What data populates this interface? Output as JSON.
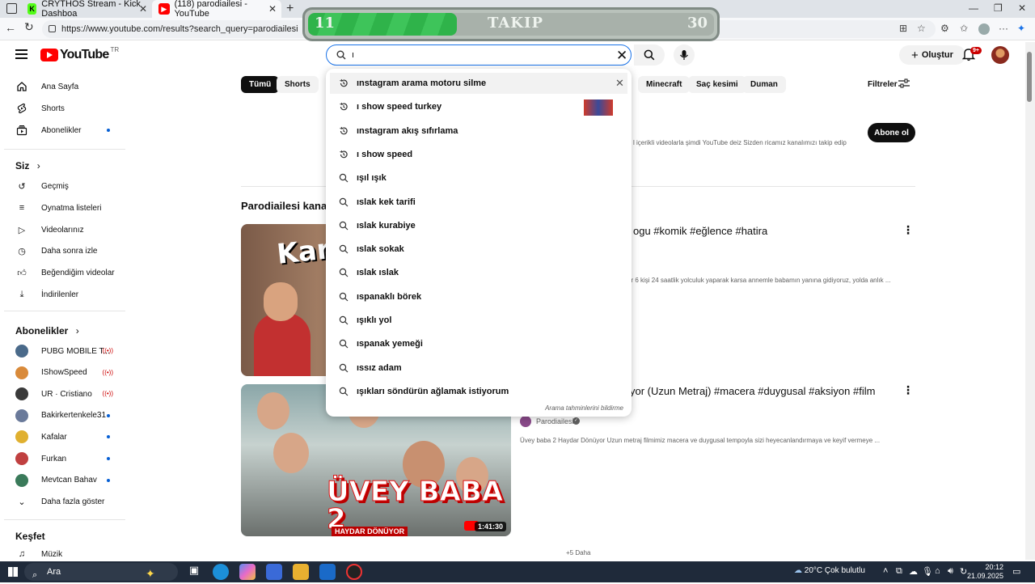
{
  "browser": {
    "tabs": [
      {
        "title": "CRYTHOS Stream - Kick Dashboa",
        "favicon": "kick-icon",
        "favicon_color": "#53fc18"
      },
      {
        "title": "(118) parodiailesi - YouTube",
        "favicon": "youtube-icon",
        "favicon_color": "#ff0000"
      }
    ],
    "url": "https://www.youtube.com/results?search_query=parodiailesi"
  },
  "overlay": {
    "current": "11",
    "label": "TAKIP",
    "goal": "30",
    "progress_fraction": 0.367,
    "fill_color": "#2fb34a"
  },
  "header": {
    "logo_text": "YouTube",
    "country_code": "TR",
    "search_value": "ı",
    "create_label": "Oluştur",
    "notifications_badge": "9+"
  },
  "sidebar": {
    "main": [
      {
        "label": "Ana Sayfa",
        "icon": "home-icon"
      },
      {
        "label": "Shorts",
        "icon": "shorts-icon"
      },
      {
        "label": "Abonelikler",
        "icon": "subscriptions-icon"
      }
    ],
    "you_heading": "Siz",
    "you": [
      {
        "label": "Geçmiş",
        "icon": "history-icon"
      },
      {
        "label": "Oynatma listeleri",
        "icon": "playlists-icon"
      },
      {
        "label": "Videolarınız",
        "icon": "your-videos-icon"
      },
      {
        "label": "Daha sonra izle",
        "icon": "watch-later-icon"
      },
      {
        "label": "Beğendiğim videolar",
        "icon": "liked-icon"
      },
      {
        "label": "İndirilenler",
        "icon": "downloads-icon"
      }
    ],
    "subs_heading": "Abonelikler",
    "subscriptions": [
      {
        "label": "PUBG MOBILE T...",
        "status": "live",
        "color": "#4a6a8a"
      },
      {
        "label": "IShowSpeed",
        "status": "live",
        "color": "#d98a3a"
      },
      {
        "label": "UR · Cristiano",
        "status": "live",
        "color": "#3a3a3a"
      },
      {
        "label": "Bakirkertenkele31",
        "status": "new",
        "color": "#6a7a9a"
      },
      {
        "label": "Kafalar",
        "status": "new",
        "color": "#e0b030"
      },
      {
        "label": "Furkan",
        "status": "new",
        "color": "#c04040"
      },
      {
        "label": "Mevtcan Bahav",
        "status": "new",
        "color": "#3a7a5a"
      }
    ],
    "show_more": "Daha fazla göster",
    "explore_heading": "Keşfet",
    "explore": [
      {
        "label": "Müzik",
        "icon": "music-icon"
      }
    ]
  },
  "chips": {
    "all": "Tümü",
    "shorts": "Shorts",
    "minecraft": "Minecraft",
    "hair": "Saç kesimi",
    "duman": "Duman",
    "filters": "Filtreler"
  },
  "channel": {
    "subscribe_label": "Abone ol",
    "description": "l içerikli videolarla şimdi YouTube deiz Sizden ricamız kanalımızı takip edip"
  },
  "results": {
    "section_title": "Parodiailesi kana",
    "videos": [
      {
        "title": "ogu #komik #eğlence #hatira",
        "description": "er 6 kişi 24 saatlik yolculuk yaparak karsa annemle babamın yanına gidiyoruz, yolda anlık ...",
        "thumb_text": "Kars Yolcul"
      },
      {
        "title": "yor (Uzun Metraj) #macera #duygusal #aksiyon #film",
        "channel": "Parodiailesi",
        "description": "Üvey baba 2 Haydar Dönüyor Uzun metraj filmimiz macera ve duygusal tempoyla sizi heyecanlandırmaya ve keyif vermeye ...",
        "thumb_title": "ÜVEY BABA 2",
        "thumb_subtitle": "HAYDAR DÖNÜYOR",
        "duration": "1:41:30"
      }
    ],
    "more_label": "+5 Daha"
  },
  "suggestions": {
    "items": [
      {
        "text": "ınstagram arama motoru silme",
        "type": "history",
        "highlighted": true
      },
      {
        "text": "ı show speed turkey",
        "type": "history",
        "highlighted": false
      },
      {
        "text": "ınstagram akış sıfırlama",
        "type": "history",
        "highlighted": false
      },
      {
        "text": "ı show speed",
        "type": "history",
        "highlighted": false
      },
      {
        "text": "ışıl ışık",
        "type": "search",
        "highlighted": false
      },
      {
        "text": "ıslak kek tarifi",
        "type": "search",
        "highlighted": false
      },
      {
        "text": "ıslak kurabiye",
        "type": "search",
        "highlighted": false
      },
      {
        "text": "ıslak sokak",
        "type": "search",
        "highlighted": false
      },
      {
        "text": "ıslak ıslak",
        "type": "search",
        "highlighted": false
      },
      {
        "text": "ıspanaklı börek",
        "type": "search",
        "highlighted": false
      },
      {
        "text": "ışıklı yol",
        "type": "search",
        "highlighted": false
      },
      {
        "text": "ıspanak yemeği",
        "type": "search",
        "highlighted": false
      },
      {
        "text": "ıssız adam",
        "type": "search",
        "highlighted": false
      },
      {
        "text": "ışıkları söndürün ağlamak istiyorum",
        "type": "search",
        "highlighted": false
      }
    ],
    "report_label": "Arama tahminlerini bildirme"
  },
  "taskbar": {
    "search_label": "Ara",
    "weather": "20°C  Çok bulutlu",
    "time": "20:12",
    "date": "21.09.2025"
  }
}
